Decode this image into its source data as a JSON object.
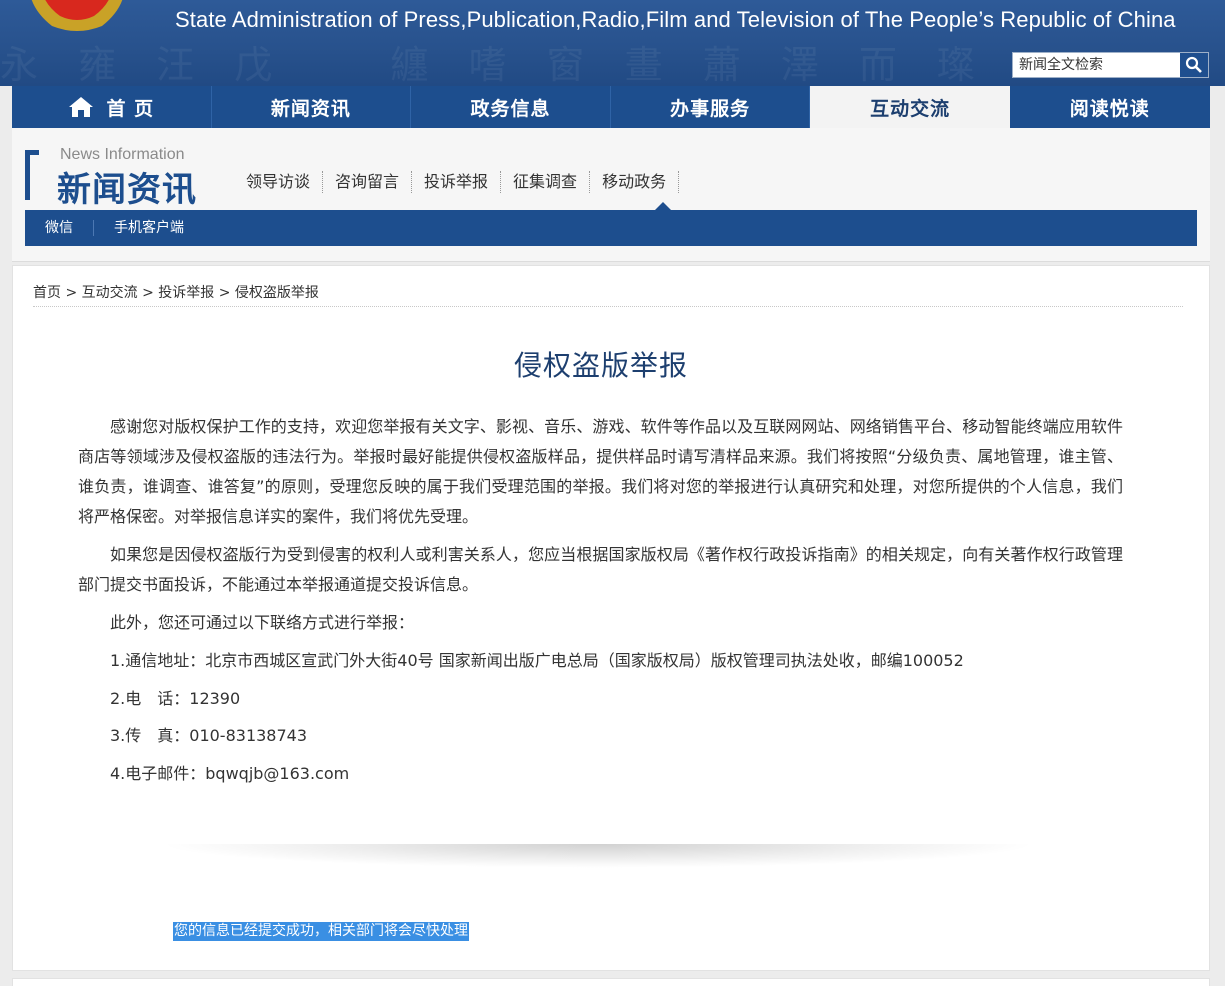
{
  "header": {
    "title": "State Administration of Press,Publication,Radio,Film and Television of The People’s Republic of China",
    "search_placeholder": "新闻全文检索"
  },
  "mainnav": {
    "items": [
      {
        "label": "首 页"
      },
      {
        "label": "新闻资讯"
      },
      {
        "label": "政务信息"
      },
      {
        "label": "办事服务"
      },
      {
        "label": "互动交流",
        "active": true
      },
      {
        "label": "阅读悦读"
      }
    ]
  },
  "section": {
    "en": "News Information",
    "cn": "新闻资讯",
    "subnav": [
      "领导访谈",
      "咨询留言",
      "投诉举报",
      "征集调查",
      "移动政务"
    ],
    "subbar": [
      "微信",
      "手机客户端"
    ]
  },
  "breadcrumb": {
    "items": [
      "首页",
      "互动交流",
      "投诉举报",
      "侵权盗版举报"
    ],
    "separator": " > "
  },
  "article": {
    "title": "侵权盗版举报",
    "paragraphs": [
      "感谢您对版权保护工作的支持，欢迎您举报有关文字、影视、音乐、游戏、软件等作品以及互联网网站、网络销售平台、移动智能终端应用软件商店等领域涉及侵权盗版的违法行为。举报时最好能提供侵权盗版样品，提供样品时请写清样品来源。我们将按照“分级负责、属地管理，谁主管、谁负责，谁调查、谁答复”的原则，受理您反映的属于我们受理范围的举报。我们将对您的举报进行认真研究和处理，对您所提供的个人信息，我们将严格保密。对举报信息详实的案件，我们将优先受理。",
      "如果您是因侵权盗版行为受到侵害的权利人或利害关系人，您应当根据国家版权局《著作权行政投诉指南》的相关规定，向有关著作权行政管理部门提交书面投诉，不能通过本举报通道提交投诉信息。",
      "此外，您还可通过以下联络方式进行举报："
    ],
    "contacts": [
      "1.通信地址：北京市西城区宣武门外大街40号 国家新闻出版广电总局（国家版权局）版权管理司执法处收，邮编100052",
      "2.电　话：12390",
      "3.传　真：010-83138743",
      "4.电子邮件：bqwqjb@163.com"
    ]
  },
  "notice": "您的信息已经提交成功，相关部门将会尽快处理",
  "colors": {
    "nav_blue": "#1d4e8e",
    "banner_blue": "#28528d",
    "title_blue": "#1d3f6f",
    "selection_blue": "#3a8fe3"
  }
}
